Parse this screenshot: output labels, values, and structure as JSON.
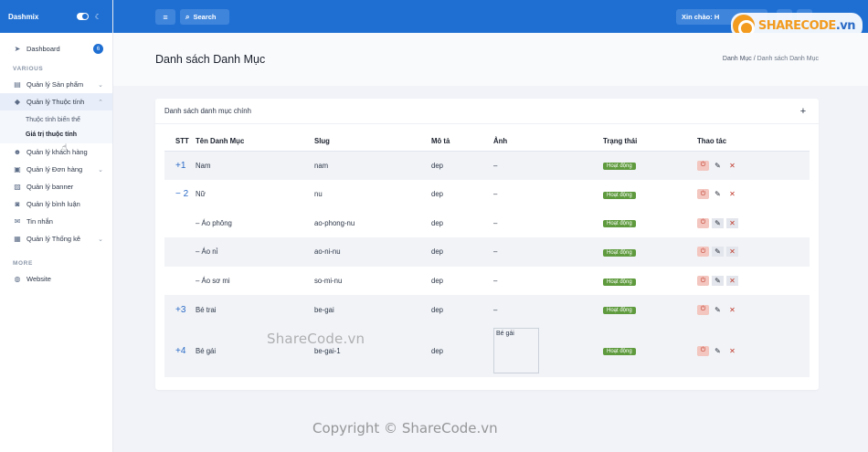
{
  "brand": {
    "name": "Dashmix"
  },
  "sidebar": {
    "dashboard": {
      "label": "Dashboard",
      "badge": "6"
    },
    "section_various": "VARIOUS",
    "items": [
      {
        "label": "Quản lý Sản phẩm",
        "icon": "box-icon"
      },
      {
        "label": "Quản lý Thuộc tính",
        "icon": "tag-icon"
      }
    ],
    "sub_items": [
      {
        "label": "Thuộc tính biến thể"
      },
      {
        "label": "Giá trị thuộc tính"
      }
    ],
    "items2": [
      {
        "label": "Quản lý khách hàng"
      },
      {
        "label": "Quản lý Đơn hàng"
      },
      {
        "label": "Quản lý banner"
      },
      {
        "label": "Quản lý bình luận"
      },
      {
        "label": "Tin nhắn"
      },
      {
        "label": "Quản lý Thống kê"
      }
    ],
    "section_more": "MORE",
    "website": "Website"
  },
  "header": {
    "search_label": "Search",
    "greeting": "Xin chào: H"
  },
  "logo": {
    "text_a": "SHARECODE",
    "text_b": ".vn"
  },
  "page": {
    "title": "Danh sách Danh Mục",
    "breadcrumb": {
      "root": "Danh Mục",
      "sep": "/",
      "current": "Danh sách Danh Mục"
    }
  },
  "card": {
    "title": "Danh sách danh mục chính",
    "add": "+"
  },
  "table": {
    "headers": [
      "STT",
      "Tên Danh Mục",
      "Slug",
      "Mô tả",
      "Ảnh",
      "Trạng thái",
      "Thao tác"
    ],
    "rows": [
      {
        "stt": "+1",
        "name": "Nam",
        "slug": "nam",
        "desc": "dep",
        "img": "–",
        "status": "Hoạt động"
      },
      {
        "stt": "− 2",
        "name": "Nữ",
        "slug": "nu",
        "desc": "dep",
        "img": "–",
        "status": "Hoạt động"
      },
      {
        "stt": "",
        "name": "– Áo phông",
        "slug": "ao-phong-nu",
        "desc": "dep",
        "img": "–",
        "status": "Hoạt động"
      },
      {
        "stt": "",
        "name": "– Áo nỉ",
        "slug": "ao-ni-nu",
        "desc": "dep",
        "img": "–",
        "status": "Hoạt động"
      },
      {
        "stt": "",
        "name": "– Áo sơ mi",
        "slug": "so-mi-nu",
        "desc": "dep",
        "img": "–",
        "status": "Hoạt động"
      },
      {
        "stt": "+3",
        "name": "Bé trai",
        "slug": "be-gai",
        "desc": "dep",
        "img": "–",
        "status": "Hoạt động"
      },
      {
        "stt": "+4",
        "name": "Bé gái",
        "slug": "be-gai-1",
        "desc": "dep",
        "img_alt": "Bé gái",
        "status": "Hoạt động"
      }
    ]
  },
  "watermarks": {
    "middle": "ShareCode.vn",
    "bottom": "Copyright © ShareCode.vn"
  }
}
